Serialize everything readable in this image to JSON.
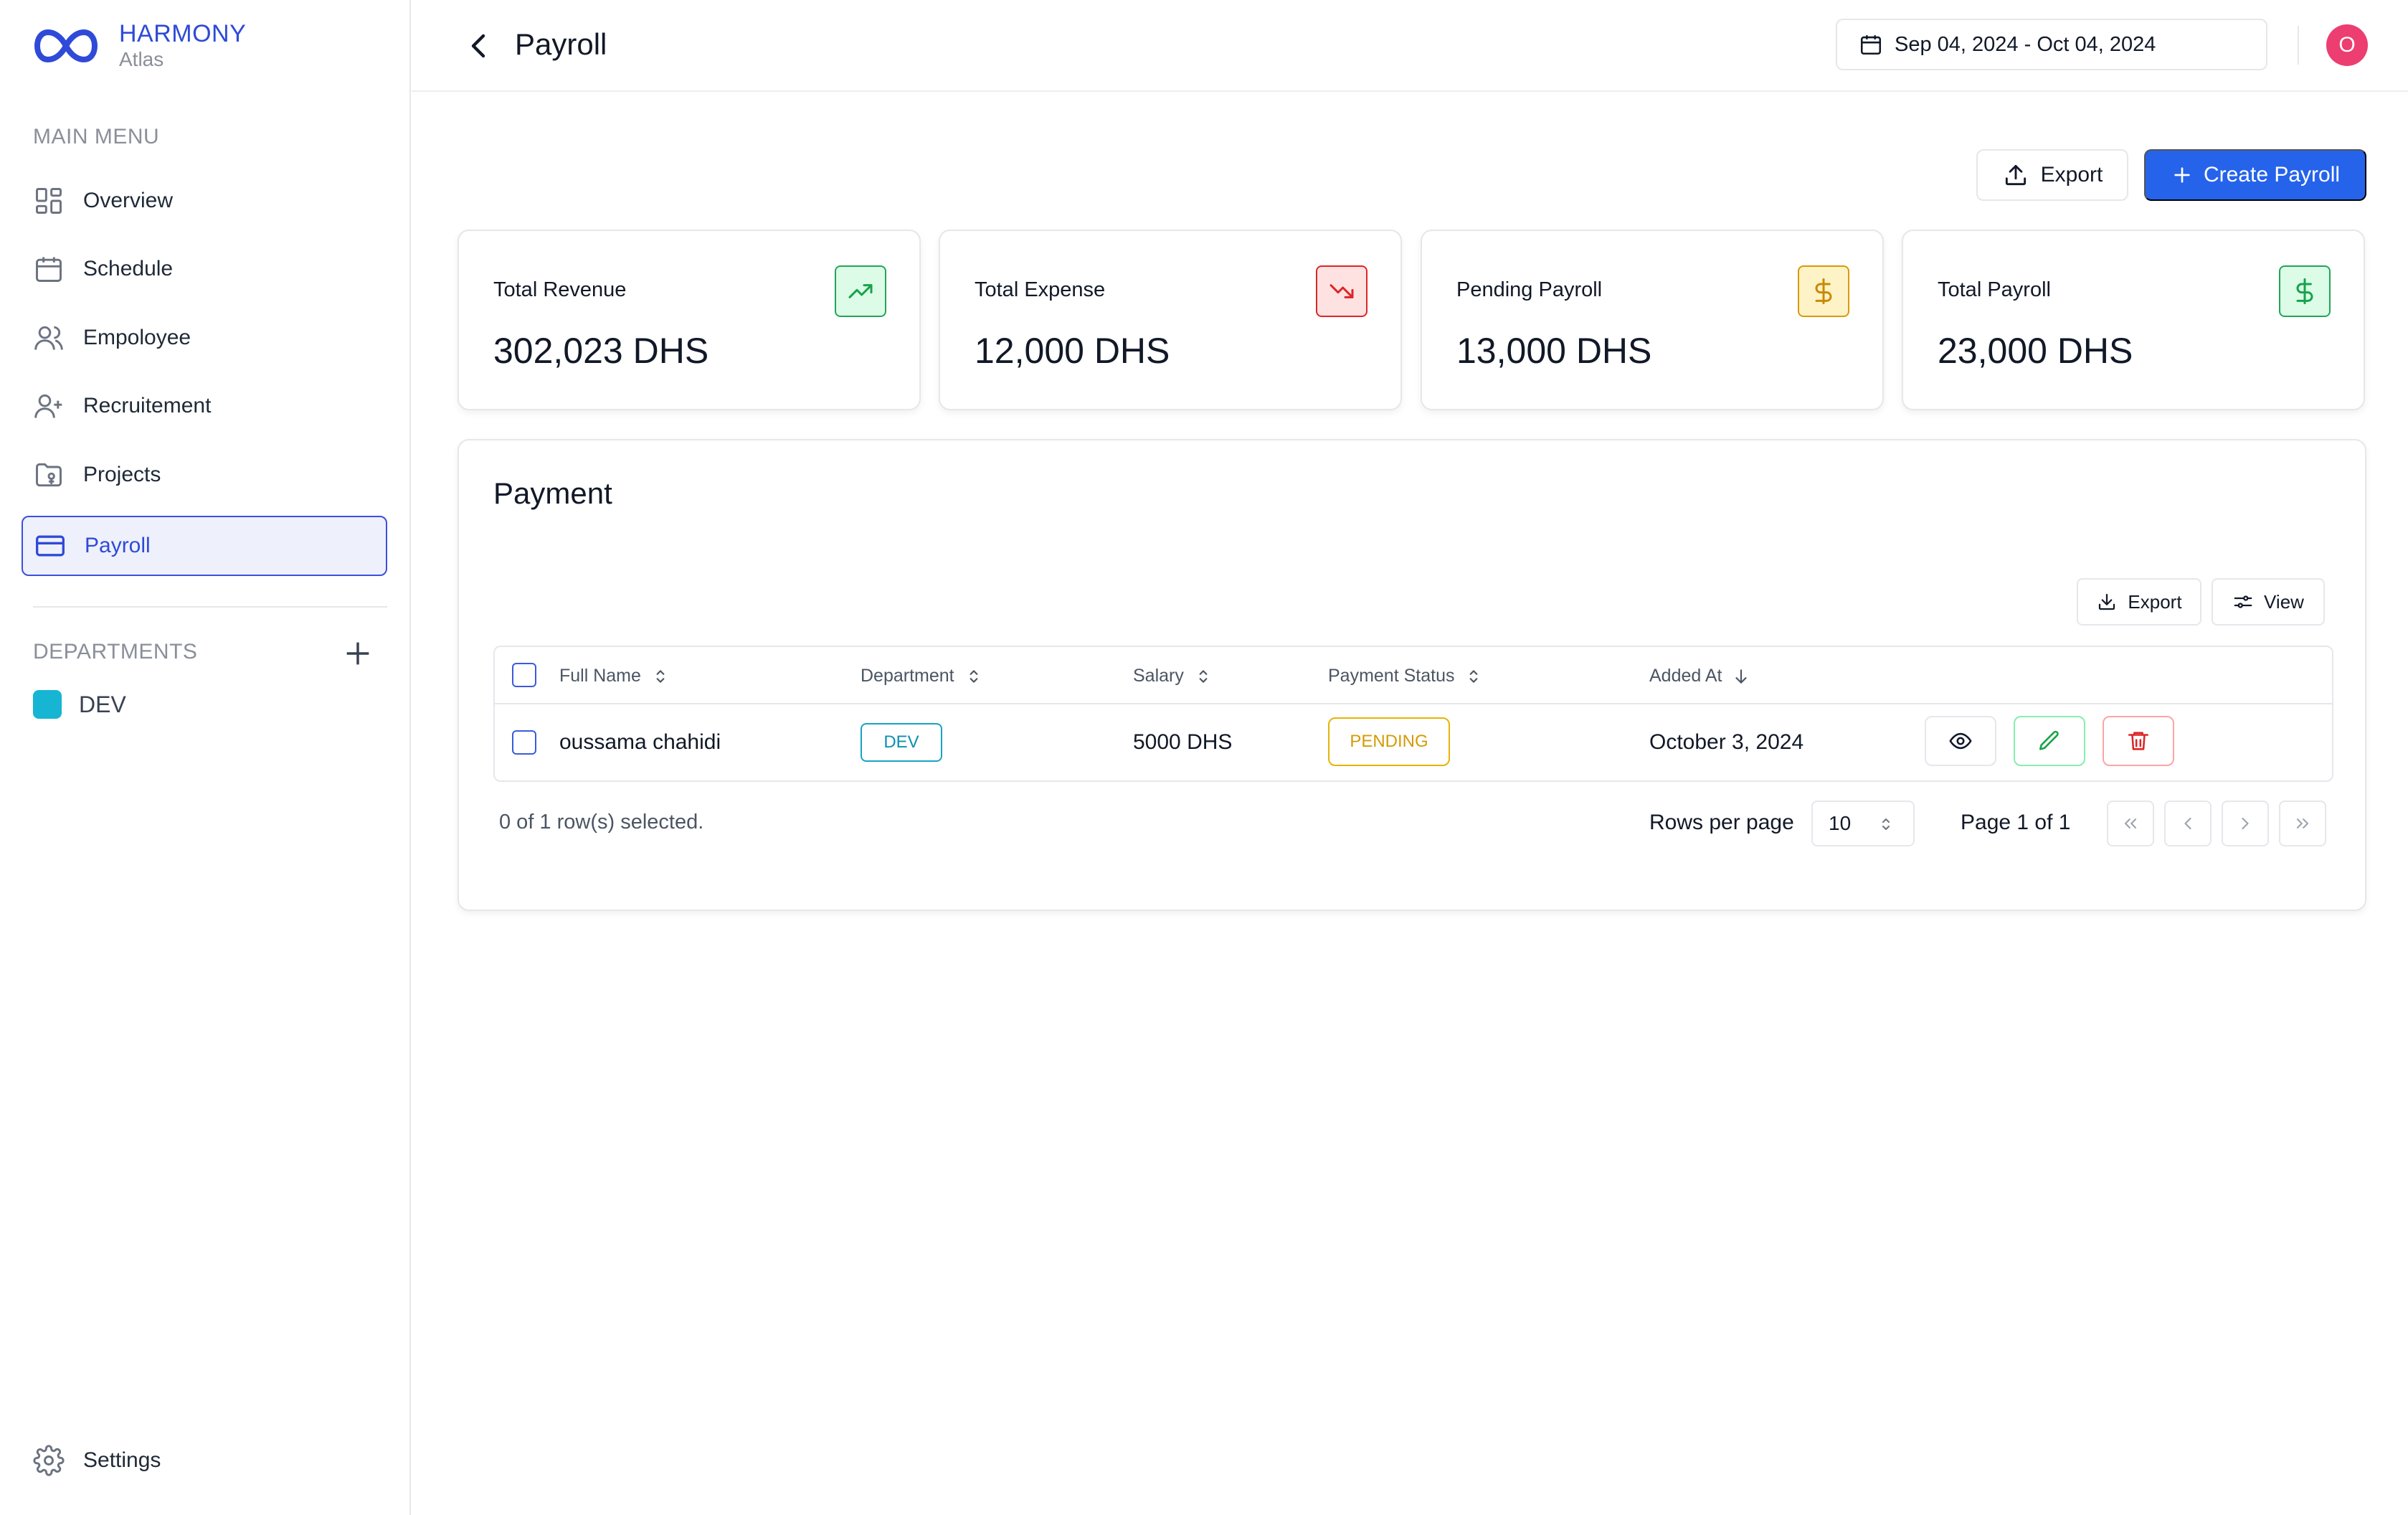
{
  "brand": {
    "name": "HARMONY",
    "subtitle": "Atlas"
  },
  "sidebar": {
    "main_menu_heading": "MAIN MENU",
    "items": [
      {
        "label": "Overview",
        "icon": "grid-icon"
      },
      {
        "label": "Schedule",
        "icon": "calendar-icon"
      },
      {
        "label": "Empoloyee",
        "icon": "users-icon"
      },
      {
        "label": "Recruitement",
        "icon": "user-plus-icon"
      },
      {
        "label": "Projects",
        "icon": "folder-icon"
      },
      {
        "label": "Payroll",
        "icon": "credit-card-icon",
        "active": true
      }
    ],
    "departments_heading": "DEPARTMENTS",
    "departments": [
      {
        "label": "DEV",
        "color": "#16b5d3"
      }
    ],
    "settings_label": "Settings"
  },
  "header": {
    "title": "Payroll",
    "date_range": "Sep 04, 2024 - Oct 04, 2024",
    "avatar_initial": "O",
    "avatar_color": "#ec3e70"
  },
  "actions": {
    "export_label": "Export",
    "create_label": "Create Payroll",
    "accent": "#2563eb"
  },
  "stats": [
    {
      "label": "Total Revenue",
      "value": "302,023 DHS",
      "icon": "trending-up-icon"
    },
    {
      "label": "Total Expense",
      "value": "12,000 DHS",
      "icon": "trending-down-icon"
    },
    {
      "label": "Pending Payroll",
      "value": "13,000 DHS",
      "icon": "dollar-icon"
    },
    {
      "label": "Total Payroll",
      "value": "23,000 DHS",
      "icon": "dollar-icon"
    }
  ],
  "payment": {
    "title": "Payment",
    "export_label": "Export",
    "view_label": "View",
    "columns": [
      "Full Name",
      "Department",
      "Salary",
      "Payment Status",
      "Added At"
    ],
    "rows": [
      {
        "full_name": "oussama chahidi",
        "department": "DEV",
        "salary": "5000 DHS",
        "status": "PENDING",
        "added_at": "October 3, 2024"
      }
    ],
    "selection_info": "0 of 1 row(s) selected.",
    "rows_per_page_label": "Rows per page",
    "rows_per_page_value": "10",
    "page_info": "Page 1 of 1"
  }
}
